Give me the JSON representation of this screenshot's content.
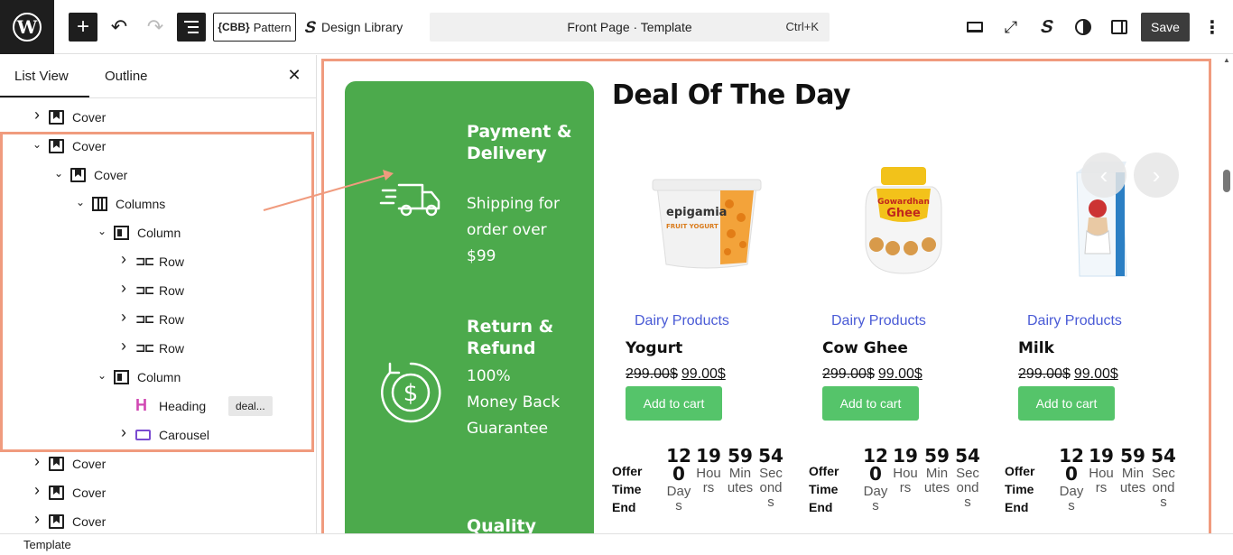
{
  "topbar": {
    "pattern_label": "Pattern",
    "pattern_badge": "{CBB}",
    "design_library_label": "Design Library",
    "command_title": "Front Page · Template",
    "command_shortcut": "Ctrl+K",
    "save_label": "Save"
  },
  "panel": {
    "tabs": [
      "List View",
      "Outline"
    ],
    "tree": [
      {
        "label": "Cover",
        "type": "cover",
        "depth": 0,
        "expanded": false
      },
      {
        "label": "Cover",
        "type": "cover",
        "depth": 0,
        "expanded": true
      },
      {
        "label": "Cover",
        "type": "cover",
        "depth": 1,
        "expanded": true
      },
      {
        "label": "Columns",
        "type": "columns",
        "depth": 2,
        "expanded": true
      },
      {
        "label": "Column",
        "type": "column",
        "depth": 3,
        "expanded": true
      },
      {
        "label": "Row",
        "type": "row",
        "depth": 4,
        "expanded": false
      },
      {
        "label": "Row",
        "type": "row",
        "depth": 4,
        "expanded": false
      },
      {
        "label": "Row",
        "type": "row",
        "depth": 4,
        "expanded": false
      },
      {
        "label": "Row",
        "type": "row",
        "depth": 4,
        "expanded": false
      },
      {
        "label": "Column",
        "type": "column",
        "depth": 3,
        "expanded": true
      },
      {
        "label": "Heading",
        "type": "heading",
        "depth": 4,
        "expanded": null,
        "tag": "deal..."
      },
      {
        "label": "Carousel",
        "type": "carousel",
        "depth": 4,
        "expanded": false
      },
      {
        "label": "Cover",
        "type": "cover",
        "depth": 0,
        "expanded": false
      },
      {
        "label": "Cover",
        "type": "cover",
        "depth": 0,
        "expanded": false
      },
      {
        "label": "Cover",
        "type": "cover",
        "depth": 0,
        "expanded": false
      }
    ]
  },
  "status": {
    "breadcrumb": "Template"
  },
  "canvas": {
    "features": [
      {
        "title": "Payment & Delivery",
        "text": "Shipping for order over $99",
        "icon": "delivery-truck-icon"
      },
      {
        "title": "Return & Refund",
        "text": "100% Money Back Guarantee",
        "icon": "refund-dollar-icon"
      },
      {
        "title": "Quality",
        "text": "",
        "icon": "quality-icon"
      }
    ],
    "deal_title": "Deal Of The Day",
    "products": [
      {
        "category": "Dairy Products",
        "name": "Yogurt",
        "old_price": "299.00$",
        "new_price": "99.00$",
        "cart": "Add to cart"
      },
      {
        "category": "Dairy Products",
        "name": "Cow Ghee",
        "old_price": "299.00$",
        "new_price": "99.00$",
        "cart": "Add to cart"
      },
      {
        "category": "Dairy Products",
        "name": "Milk",
        "old_price": "299.00$",
        "new_price": "99.00$",
        "cart": "Add to cart"
      }
    ],
    "offer_label": "Offer Time End",
    "countdown": [
      {
        "num": "120",
        "unit": "Days"
      },
      {
        "num": "19",
        "unit": "Hours"
      },
      {
        "num": "59",
        "unit": "Minutes"
      },
      {
        "num": "54",
        "unit": "Seconds"
      }
    ],
    "product_text": {
      "yogurt_brand": "epigamia",
      "yogurt_type": "FRUIT YOGURT",
      "ghee_brand": "Gowardhan",
      "ghee_name": "Ghee"
    }
  },
  "colors": {
    "green_card": "#4caa4c",
    "cart_button": "#55c46a",
    "category_link": "#4a5bd6",
    "highlight": "#f09b7e"
  }
}
